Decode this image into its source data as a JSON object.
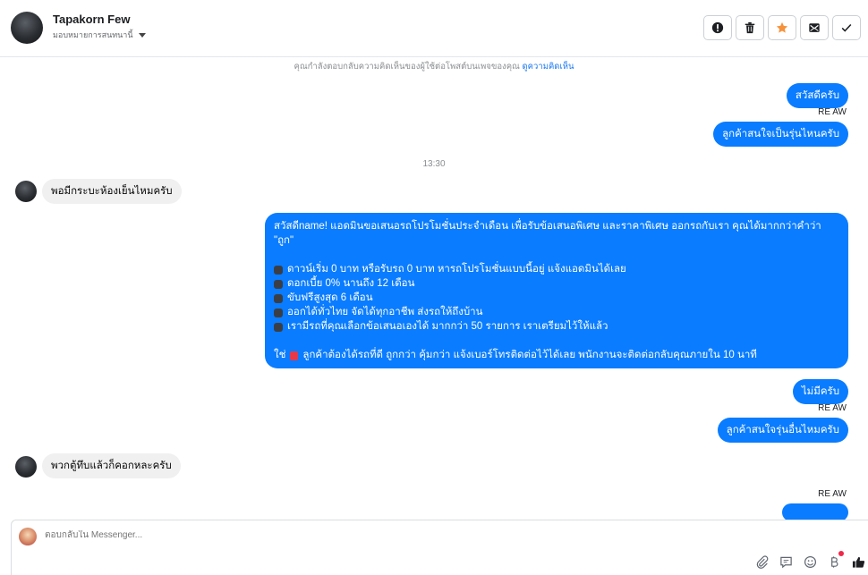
{
  "header": {
    "name": "Tapakorn Few",
    "assign_label": "มอบหมายการสนทนานี้",
    "actions": [
      {
        "name": "report-icon",
        "label": "!"
      },
      {
        "name": "trash-icon",
        "label": ""
      },
      {
        "name": "star-icon",
        "label": ""
      },
      {
        "name": "mark-unread-icon",
        "label": ""
      },
      {
        "name": "done-icon",
        "label": ""
      }
    ]
  },
  "context": {
    "text": "คุณกำลังตอบกลับความคิดเห็นของผู้ใช้ต่อโพสต์บนเพจของคุณ",
    "link": "ดูความคิดเห็น"
  },
  "messages": {
    "m1": "สวัสดีครับ",
    "sender1": "RE AW",
    "m2": "ลูกค้าสนใจเป็นรุ่นไหนครับ",
    "time": "13:30",
    "m3": "พอมีกระบะห้องเย็นไหมครับ",
    "long_line1": "สวัสดีname! แอดมินขอเสนอรถโปรโมชั่นประจำเดือน เพื่อรับข้อเสนอพิเศษ และราคาพิเศษ ออกรถกับเรา คุณได้มากกว่าคำว่า",
    "long_line2": "\"ถูก\"",
    "bullets": [
      "ดาวน์เริ่ม 0 บาท หรือรับรถ 0 บาท หารถโปรโมชั่นแบบนี้อยู่ แจ้งแอดมินได้เลย",
      "ดอกเบี้ย 0% นานถึง 12 เดือน",
      "ขับฟรีสูงสุด 6 เดือน",
      "ออกได้ทั่วไทย จัดได้ทุกอาชีพ ส่งรถให้ถึงบ้าน",
      "เรามีรถที่คุณเลือกข้อเสนอเองได้ มากกว่า 50 รายการ เราเตรียมไว้ให้แล้ว"
    ],
    "long_last_pre": "ใช่",
    "long_last_post": "ลูกค้าต้องได้รถที่ดี ถูกกว่า คุ้มกว่า แจ้งเบอร์โทรติดต่อไว้ได้เลย พนักงานจะติดต่อกลับคุณภายใน 10 นาที",
    "m4": "ไม่มีครับ",
    "sender2": "RE AW",
    "m5": "ลูกค้าสนใจรุ่นอื่นไหมครับ",
    "m6": "พวกตู้ทึบแล้วก็คอกหละครับ",
    "sender3": "RE AW"
  },
  "composer": {
    "placeholder": "ตอบกลับใน Messenger..."
  },
  "colors": {
    "outgoing_bubble": "#0a7cff",
    "incoming_bubble": "#f0f0f0",
    "accent_star": "#f7923b",
    "link": "#1877f2"
  }
}
